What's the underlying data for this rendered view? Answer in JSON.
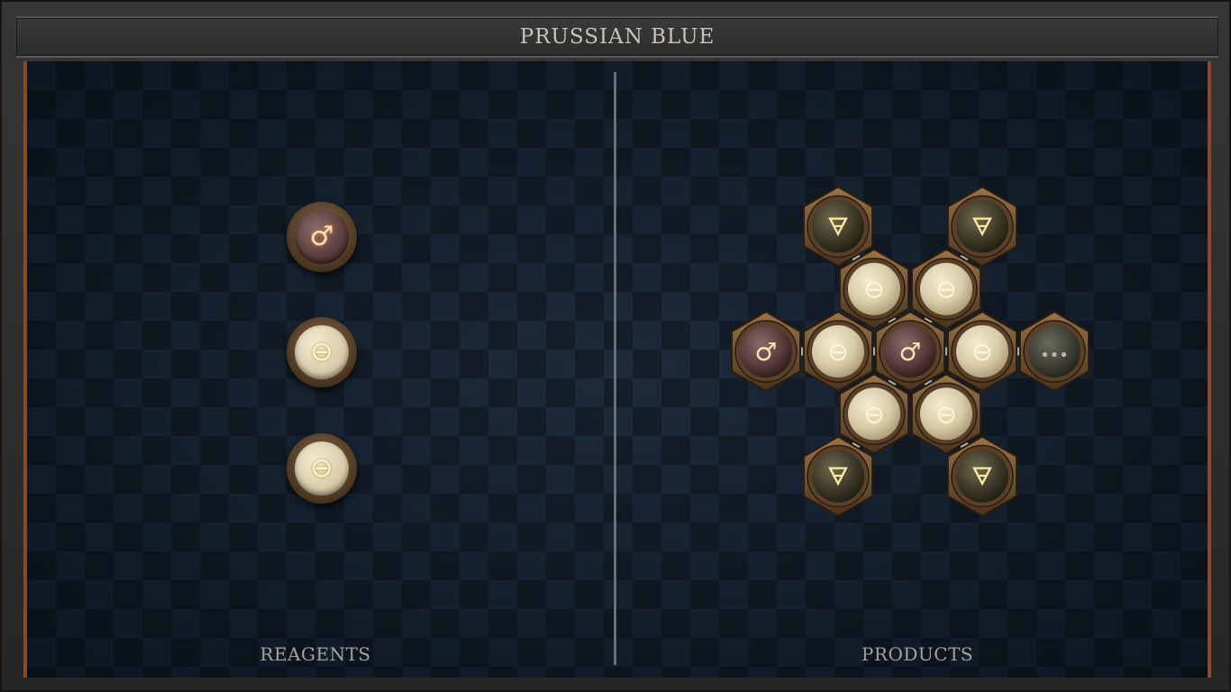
{
  "title": "PRUSSIAN BLUE",
  "panels": {
    "reagents_label": "REAGENTS",
    "products_label": "PRODUCTS"
  },
  "glyphs": {
    "iron": "♂",
    "salt": "⊖",
    "earth": "🜃",
    "quintessence": "•••"
  },
  "reagents": [
    "iron",
    "salt",
    "salt"
  ],
  "product_molecule": {
    "center": "iron",
    "left": [
      "salt",
      "iron"
    ],
    "right": [
      "salt",
      "quintessence"
    ],
    "upper_left": [
      "salt",
      "earth"
    ],
    "upper_right": [
      "salt",
      "earth"
    ],
    "lower_left": [
      "salt",
      "earth"
    ],
    "lower_right": [
      "salt",
      "earth"
    ]
  },
  "colors": {
    "board": "#142233",
    "frame_accent": "#8a4a28",
    "title_text": "#c9c3b8",
    "label_text": "#a8a39a"
  }
}
